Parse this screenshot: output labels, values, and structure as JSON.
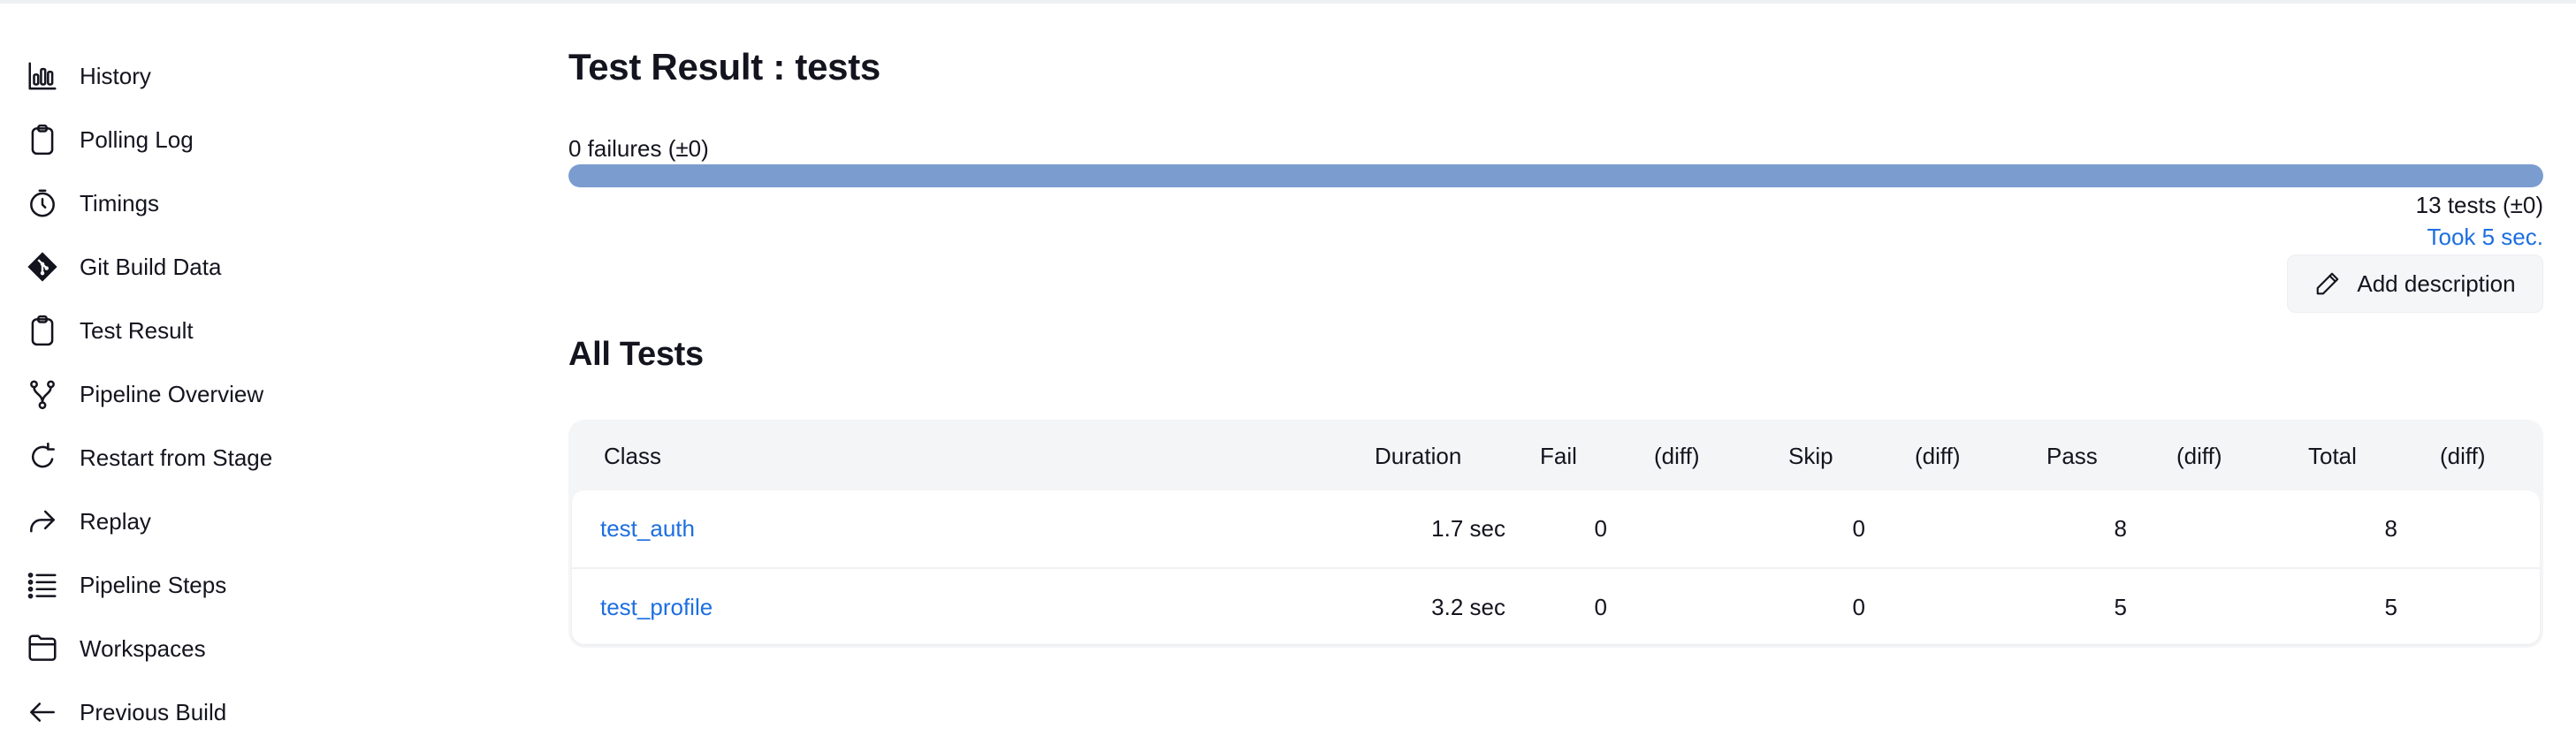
{
  "sidebar": {
    "items": [
      {
        "label": "History",
        "icon": "bar-chart-icon"
      },
      {
        "label": "Polling Log",
        "icon": "clipboard-icon"
      },
      {
        "label": "Timings",
        "icon": "stopwatch-icon"
      },
      {
        "label": "Git Build Data",
        "icon": "git-icon"
      },
      {
        "label": "Test Result",
        "icon": "clipboard-icon"
      },
      {
        "label": "Pipeline Overview",
        "icon": "branch-icon"
      },
      {
        "label": "Restart from Stage",
        "icon": "restart-icon"
      },
      {
        "label": "Replay",
        "icon": "replay-icon"
      },
      {
        "label": "Pipeline Steps",
        "icon": "list-steps-icon"
      },
      {
        "label": "Workspaces",
        "icon": "folder-icon"
      },
      {
        "label": "Previous Build",
        "icon": "arrow-left-icon"
      }
    ]
  },
  "main": {
    "title": "Test Result : tests",
    "failures_summary": "0 failures (±0)",
    "progress_pass_fraction": 1.0,
    "tests_summary": "13 tests (±0)",
    "took_link": "Took 5 sec.",
    "add_description": "Add description",
    "all_tests_title": "All Tests",
    "table": {
      "headers": [
        "Class",
        "Duration",
        "Fail",
        "(diff)",
        "Skip",
        "(diff)",
        "Pass",
        "(diff)",
        "Total",
        "(diff)"
      ],
      "rows": [
        {
          "class": "test_auth",
          "duration": "1.7 sec",
          "fail": "0",
          "fail_diff": "",
          "skip": "0",
          "skip_diff": "",
          "pass": "8",
          "pass_diff": "",
          "total": "8",
          "total_diff": ""
        },
        {
          "class": "test_profile",
          "duration": "3.2 sec",
          "fail": "0",
          "fail_diff": "",
          "skip": "0",
          "skip_diff": "",
          "pass": "5",
          "pass_diff": "",
          "total": "5",
          "total_diff": ""
        }
      ]
    }
  },
  "colors": {
    "link": "#1d6fe0",
    "progress_pass": "#7b9ccf",
    "table_bg": "#f4f5f7"
  }
}
